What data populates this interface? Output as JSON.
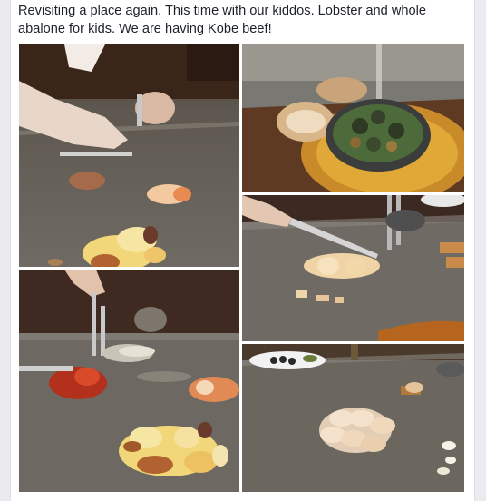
{
  "post": {
    "text": "Revisiting a place again. This time with our kiddos. Lobster and whole abalone for kids. We are having Kobe beef!"
  },
  "photos": [
    {
      "subject": "chef-cutting-lobster-on-griddle"
    },
    {
      "subject": "bread-and-escargot-pan"
    },
    {
      "subject": "chef-slicing-abalone"
    },
    {
      "subject": "lobster-shell-and-vegetables-on-griddle"
    },
    {
      "subject": "seared-scallops-on-griddle"
    }
  ],
  "colors": {
    "page_background": "#e9ebee",
    "card_background": "#ffffff",
    "text": "#1d2129",
    "griddle": "#6e6a63",
    "counter_wood": "#4a2a1c"
  }
}
